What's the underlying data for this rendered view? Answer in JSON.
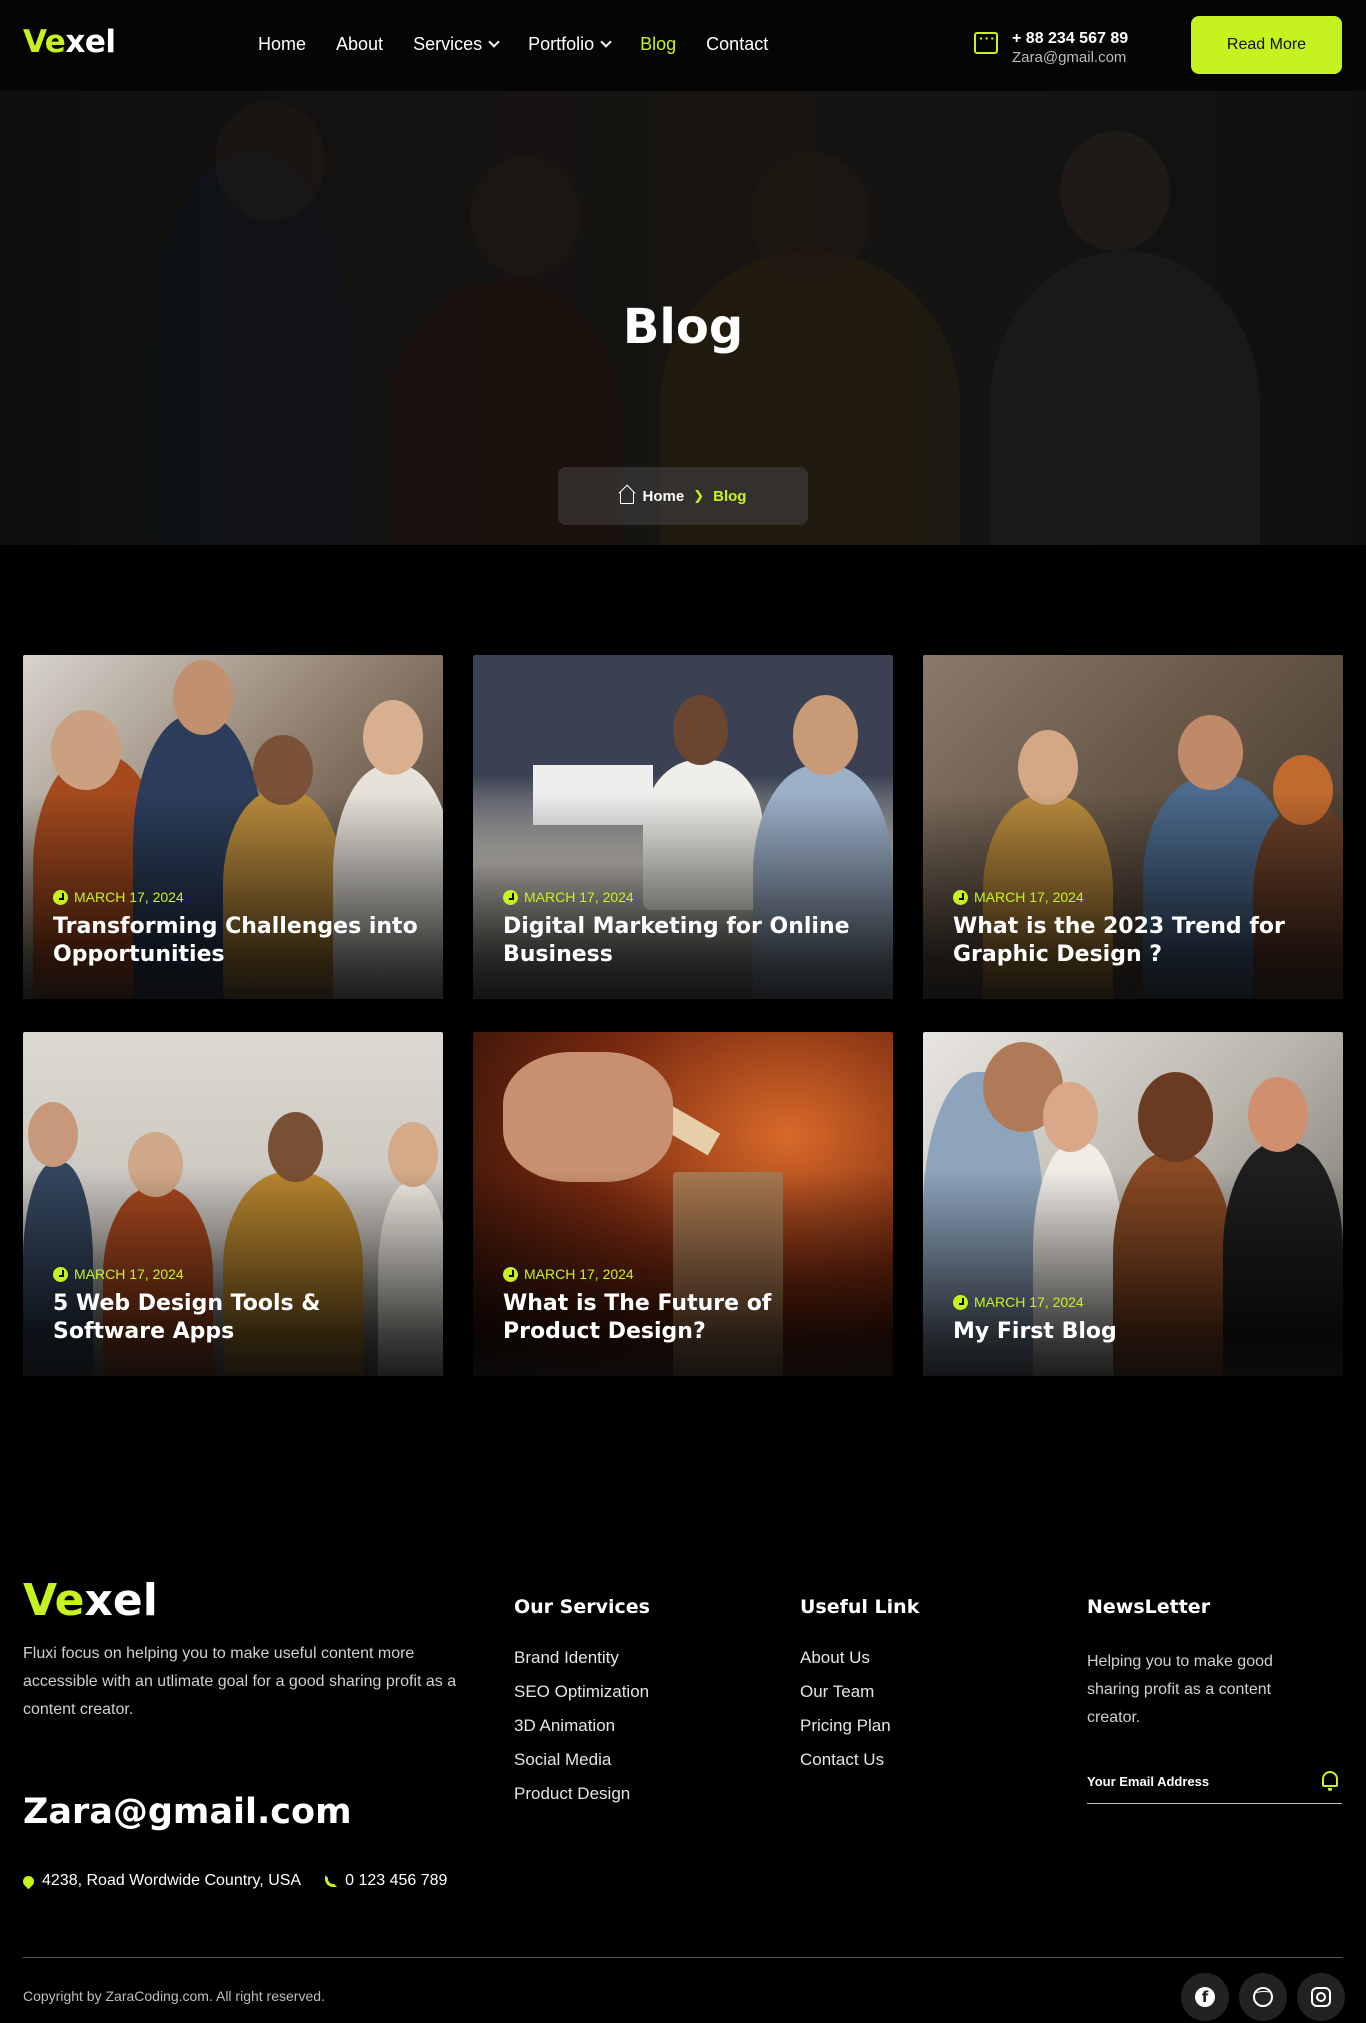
{
  "brand": {
    "logo_prefix": "Ve",
    "logo_suffix": "xel"
  },
  "nav": {
    "items": [
      {
        "label": "Home",
        "dropdown": false
      },
      {
        "label": "About",
        "dropdown": false
      },
      {
        "label": "Services",
        "dropdown": true
      },
      {
        "label": "Portfolio",
        "dropdown": true
      },
      {
        "label": "Blog",
        "dropdown": false,
        "active": true
      },
      {
        "label": "Contact",
        "dropdown": false
      }
    ]
  },
  "header_contact": {
    "phone": "+ 88 234 567 89",
    "email": "Zara@gmail.com",
    "icon": "chat-icon"
  },
  "header_button": "Read More",
  "hero": {
    "title": "Blog",
    "breadcrumb": {
      "home": "Home",
      "current": "Blog",
      "home_icon": "home-icon"
    }
  },
  "posts": [
    {
      "date": "MARCH 17, 2024",
      "title": "Transforming Challenges into Opportunities"
    },
    {
      "date": "MARCH 17, 2024",
      "title": "Digital Marketing for Online Business"
    },
    {
      "date": "MARCH 17, 2024",
      "title": "What is the 2023 Trend for Graphic Design ?"
    },
    {
      "date": "MARCH 17, 2024",
      "title": "5 Web Design Tools & Software Apps"
    },
    {
      "date": "MARCH 17, 2024",
      "title": "What is The Future of Product Design?"
    },
    {
      "date": "MARCH 17, 2024",
      "title": "My First Blog"
    }
  ],
  "footer": {
    "logo_prefix": "Ve",
    "logo_suffix": "xel",
    "description": "Fluxi focus on helping you to make useful content more accessible with an utlimate goal for a good sharing profit as a content creator.",
    "email": "Zara@gmail.com",
    "address": "4238, Road Wordwide Country, USA",
    "phone": "0 123 456 789",
    "services": {
      "heading": "Our Services",
      "items": [
        "Brand Identity",
        "SEO Optimization",
        "3D Animation",
        "Social Media",
        "Product Design"
      ]
    },
    "links": {
      "heading": "Useful Link",
      "items": [
        "About Us",
        "Our Team",
        "Pricing Plan",
        "Contact Us"
      ]
    },
    "newsletter": {
      "heading": "NewsLetter",
      "text": "Helping you to make  good sharing profit as a content creator.",
      "placeholder": "Your Email Address"
    },
    "copyright": "Copyright by ZaraCoding.com. All right reserved.",
    "social": [
      "facebook-icon",
      "dribbble-icon",
      "instagram-icon"
    ],
    "facebook_glyph": "f"
  },
  "colors": {
    "accent": "#c6f31f",
    "background": "#000000",
    "header": "#050505"
  }
}
